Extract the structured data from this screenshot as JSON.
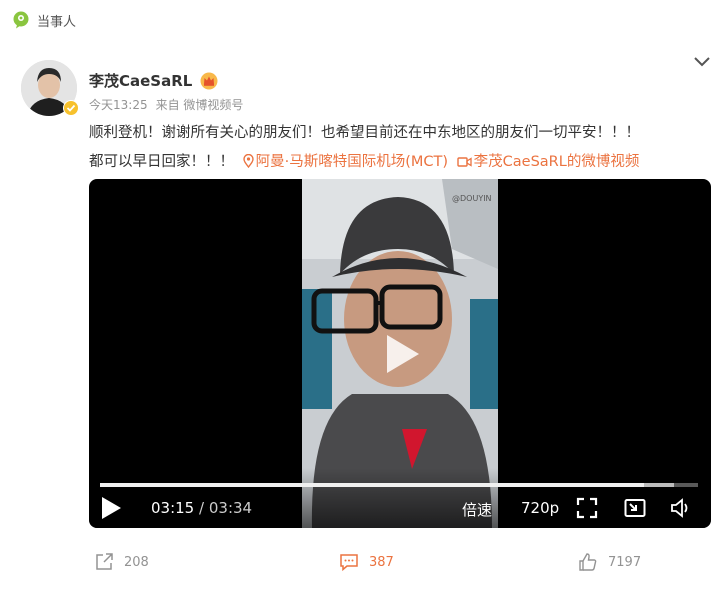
{
  "tag": {
    "label": "当事人",
    "icon": "speech-bubble-tag-icon",
    "color": "#8ac53f"
  },
  "post": {
    "username": "李茂CaeSaRL",
    "badge_icon": "crown-member-icon",
    "timestamp": "今天13:25",
    "source": "来自 微博视频号",
    "text_line1": "顺利登机！谢谢所有关心的朋友们！也希望目前还在中东地区的朋友们一切平安！！！",
    "text_line2": "都可以早日回家！！！",
    "location": "阿曼·马斯喀特国际机场(MCT)",
    "video_link": "李茂CaeSaRL的微博视频",
    "link_color": "#eb7340"
  },
  "video": {
    "current_time": "03:15",
    "separator": "/",
    "duration": "03:34",
    "progress_fraction": 0.91,
    "buffered_fraction": 0.96,
    "speed_label": "倍速",
    "quality_label": "720p",
    "watermark": "@DOUYIN"
  },
  "actions": {
    "reposts": "208",
    "comments": "387",
    "likes": "7197"
  }
}
